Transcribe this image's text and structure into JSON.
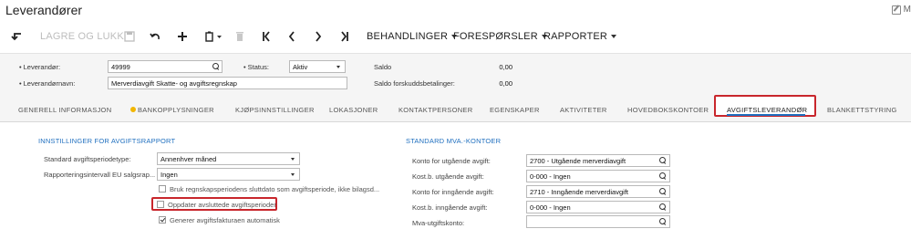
{
  "page": {
    "title": "Leverandører",
    "corner_link": "M"
  },
  "toolbar": {
    "save_close_label": "LAGRE OG LUKK",
    "menus": [
      "BEHANDLINGER",
      "FORESPØRSLER",
      "RAPPORTER"
    ]
  },
  "header": {
    "vendor_label": "Leverandør:",
    "vendor_value": "49999",
    "vendor_name_label": "Leverandørnavn:",
    "vendor_name_value": "Merverdiavgift Skatte- og avgiftsregnskap",
    "status_label": "Status:",
    "status_value": "Aktiv",
    "balance_label": "Saldo",
    "balance_value": "0,00",
    "prepayment_label": "Saldo forskuddsbetalinger:",
    "prepayment_value": "0,00"
  },
  "tabs": [
    "GENERELL INFORMASJON",
    "BANKOPPLYSNINGER",
    "KJØPSINNSTILLINGER",
    "LOKASJONER",
    "KONTAKTPERSONER",
    "EGENSKAPER",
    "AKTIVITETER",
    "HOVEDBOKSKONTOER",
    "AVGIFTSLEVERANDØR",
    "BLANKETTSTYRING"
  ],
  "tax_settings": {
    "title": "INNSTILLINGER FOR AVGIFTSRAPPORT",
    "period_type_label": "Standard avgiftsperiodetype:",
    "period_type_value": "Annenhver måned",
    "eu_interval_label": "Rapporteringsintervall EU salgsrap...",
    "eu_interval_value": "Ingen",
    "checkbox_1": "Bruk regnskapsperiodens sluttdato som avgiftsperiode, ikke bilagsd...",
    "checkbox_2": "Oppdater avsluttede avgiftsperioder",
    "checkbox_3": "Generer avgiftsfakturaen automatisk"
  },
  "vat_accounts": {
    "title": "STANDARD MVA.-KONTOER",
    "rows": [
      {
        "label": "Konto for utgående avgift:",
        "value": "2700 - Utgående merverdiavgift"
      },
      {
        "label": "Kost.b. utgående avgift:",
        "value": "0-000 - Ingen"
      },
      {
        "label": "Konto for inngående avgift:",
        "value": "2710 - Inngående merverdiavgift"
      },
      {
        "label": "Kost.b. inngående avgift:",
        "value": "0-000 - Ingen"
      },
      {
        "label": "Mva-utgiftskonto:",
        "value": ""
      }
    ]
  },
  "colors": {
    "accent": "#1f6fbf",
    "highlight": "#c8262c"
  }
}
